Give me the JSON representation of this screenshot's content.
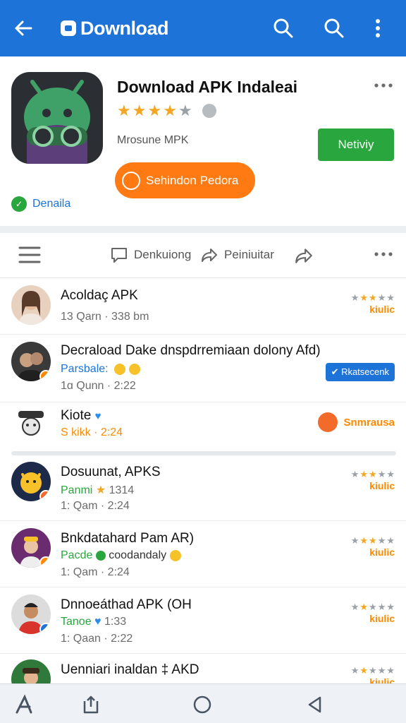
{
  "appbar": {
    "title": "Download",
    "color": "#1e73d8"
  },
  "app": {
    "name": "Download APK Indaleai",
    "rating": 3.5,
    "stars_total": 5,
    "subtitle": "Mrosune MPK",
    "primary_button": "Netiviy",
    "secondary_button": "Sehindon Pedora",
    "verified_label": "Denaila"
  },
  "toolbar": {
    "item1": "Denkuiong",
    "item2": "Peiniuitar"
  },
  "items": [
    {
      "title": "Acoldaç APK",
      "line2": "",
      "meta": "13 Qarn · 338 bm",
      "right": "kiulic",
      "right_kind": "stars",
      "stars": 3
    },
    {
      "title": "Decraload Dake dnspdrremiaan dolony Afd)",
      "line2": "Parsbale:",
      "meta": "1ɑ Qunn · 2:22",
      "right": "✔ Rkatsecenk",
      "right_kind": "chip"
    },
    {
      "title": "Kiote",
      "line2": "S kikk · 2:24",
      "meta": "",
      "right": "Snmrausa",
      "right_kind": "text"
    },
    {
      "title": "Dosuunat, APKS",
      "line2": "Panmi",
      "line2_suffix": "1314",
      "meta": "1: Qam · 2:24",
      "right": "kiulic",
      "right_kind": "stars",
      "stars": 3
    },
    {
      "title": "Bnkdatahard Pam AR)",
      "line2": "Pacde",
      "line2_suffix": "coodandaly",
      "meta": "1: Qam · 2:24",
      "right": "kiulic",
      "right_kind": "stars",
      "stars": 3
    },
    {
      "title": "Dnnoeáthad APK (OH",
      "line2": "Tanoe",
      "line2_suffix": "1:33",
      "meta": "1: Qaan · 2:22",
      "right": "kiulic",
      "right_kind": "stars",
      "stars": 2
    },
    {
      "title": "Uenniari inaldan ‡ AKD",
      "line2": "",
      "meta": "",
      "right": "kiulic",
      "right_kind": "stars",
      "stars": 2
    }
  ]
}
